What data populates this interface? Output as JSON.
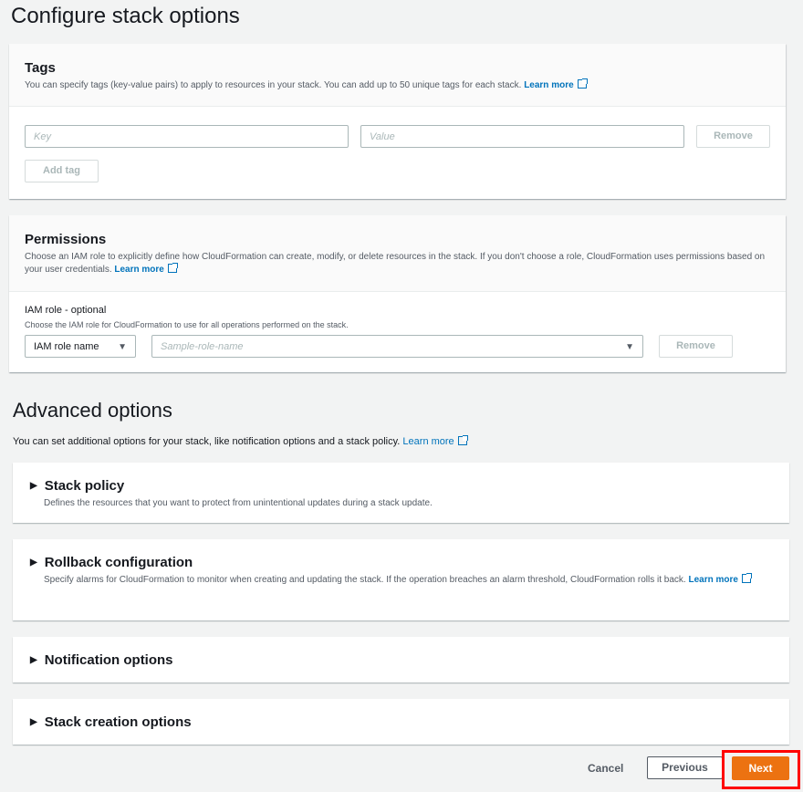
{
  "page_title": "Configure stack options",
  "tags": {
    "title": "Tags",
    "description": "You can specify tags (key-value pairs) to apply to resources in your stack. You can add up to 50 unique tags for each stack.",
    "learn_more": "Learn more",
    "key_placeholder": "Key",
    "value_placeholder": "Value",
    "remove": "Remove",
    "add_tag": "Add tag"
  },
  "permissions": {
    "title": "Permissions",
    "description": "Choose an IAM role to explicitly define how CloudFormation can create, modify, or delete resources in the stack. If you don't choose a role, CloudFormation uses permissions based on your user credentials.",
    "learn_more": "Learn more",
    "iam_label": "IAM role - optional",
    "iam_desc": "Choose the IAM role for CloudFormation to use for all operations performed on the stack.",
    "iam_type": "IAM role name",
    "role_placeholder": "Sample-role-name",
    "remove": "Remove"
  },
  "advanced": {
    "title": "Advanced options",
    "description": "You can set additional options for your stack, like notification options and a stack policy.",
    "learn_more": "Learn more",
    "sections": [
      {
        "title": "Stack policy",
        "description": "Defines the resources that you want to protect from unintentional updates during a stack update."
      },
      {
        "title": "Rollback configuration",
        "description": "Specify alarms for CloudFormation to monitor when creating and updating the stack. If the operation breaches an alarm threshold, CloudFormation rolls it back.",
        "learn_more": "Learn more"
      },
      {
        "title": "Notification options"
      },
      {
        "title": "Stack creation options"
      }
    ]
  },
  "footer": {
    "cancel": "Cancel",
    "previous": "Previous",
    "next": "Next"
  },
  "colors": {
    "primary": "#ec7211",
    "link": "#0073bb",
    "highlight": "#ff0000"
  }
}
